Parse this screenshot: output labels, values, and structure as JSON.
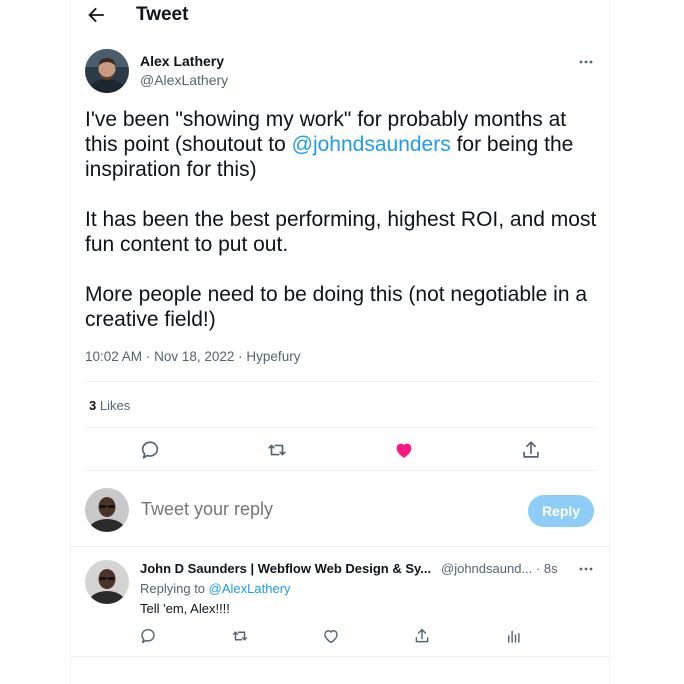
{
  "header": {
    "title": "Tweet",
    "back_icon": "arrow-left-icon"
  },
  "tweet": {
    "author_name": "Alex Lathery",
    "author_handle": "@AlexLathery",
    "paragraphs": [
      {
        "before": "I've been \"showing my work\" for probably months at this point (shoutout to ",
        "mention": "@johndsaunders",
        "after": "  for being the inspiration for this)"
      },
      {
        "text": "It has been the best performing, highest ROI, and most fun content to put out."
      },
      {
        "text": "More people need to be doing this (not negotiable in a creative field!)"
      }
    ],
    "time": "10:02 AM",
    "date": "Nov 18, 2022",
    "source": "Hypefury",
    "sep": "·",
    "likes_count": "3",
    "likes_label": "Likes",
    "liked": true,
    "like_color": "#f91880",
    "actions": [
      "reply-icon",
      "retweet-icon",
      "heart-filled-icon",
      "share-icon"
    ]
  },
  "compose": {
    "placeholder": "Tweet your reply",
    "reply_button": "Reply",
    "reply_button_color": "#8ecdf8"
  },
  "reply": {
    "author_name": "John D Saunders | Webflow Web Design & Sy...",
    "author_handle": "@johndsaund...",
    "sep": "·",
    "age": "8s",
    "replying_prefix": "Replying to",
    "replying_to": "@AlexLathery",
    "text": "Tell 'em, Alex!!!!",
    "actions": [
      "reply-icon",
      "retweet-icon",
      "heart-outline-icon",
      "share-icon",
      "analytics-icon"
    ]
  },
  "colors": {
    "accent": "#1d9bf0",
    "text": "#0f1419",
    "muted": "#536471",
    "border": "#eff3f4"
  }
}
